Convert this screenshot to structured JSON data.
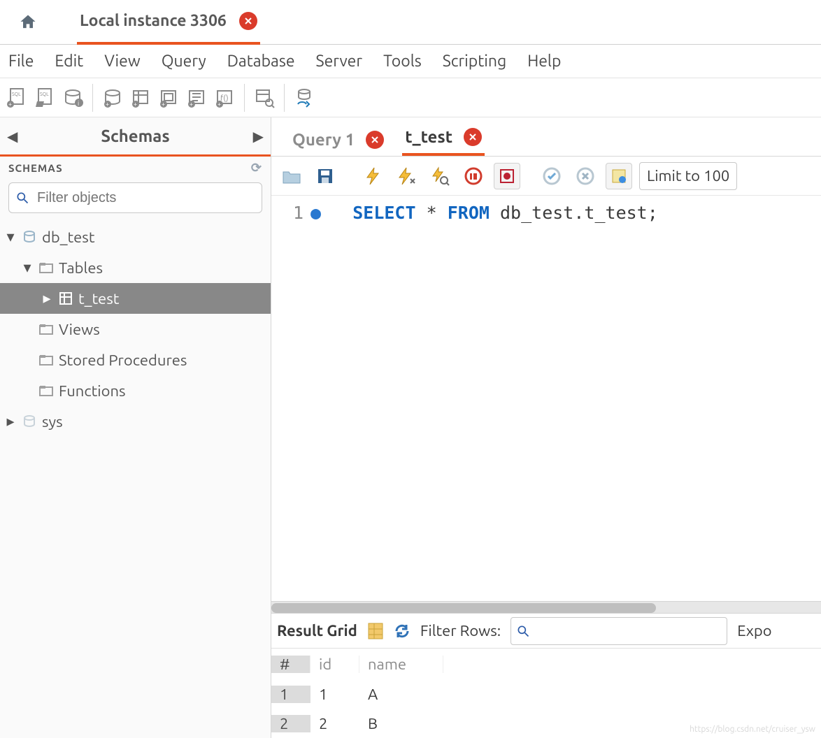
{
  "topTabs": {
    "connection_label": "Local instance 3306"
  },
  "menu": {
    "items": [
      "File",
      "Edit",
      "View",
      "Query",
      "Database",
      "Server",
      "Tools",
      "Scripting",
      "Help"
    ]
  },
  "sidebar": {
    "panel_title": "Schemas",
    "section_label": "SCHEMAS",
    "filter_placeholder": "Filter objects",
    "tree": {
      "db": "db_test",
      "tables_label": "Tables",
      "table": "t_test",
      "views_label": "Views",
      "procs_label": "Stored Procedures",
      "funcs_label": "Functions",
      "sys_label": "sys"
    }
  },
  "editorTabs": [
    {
      "label": "Query 1",
      "active": false
    },
    {
      "label": "t_test",
      "active": true
    }
  ],
  "sqlToolbar": {
    "limit_label": "Limit to 100"
  },
  "editor": {
    "line_no": "1",
    "kw_select": "SELECT",
    "star": "*",
    "kw_from": "FROM",
    "expr": "db_test.t_test;"
  },
  "result": {
    "grid_label": "Result Grid",
    "filter_rows_label": "Filter Rows:",
    "export_label": "Expo",
    "columns": [
      "#",
      "id",
      "name"
    ],
    "rows": [
      {
        "n": "1",
        "id": "1",
        "name": "A"
      },
      {
        "n": "2",
        "id": "2",
        "name": "B"
      }
    ]
  },
  "watermark": "https://blog.csdn.net/cruiser_ysw"
}
